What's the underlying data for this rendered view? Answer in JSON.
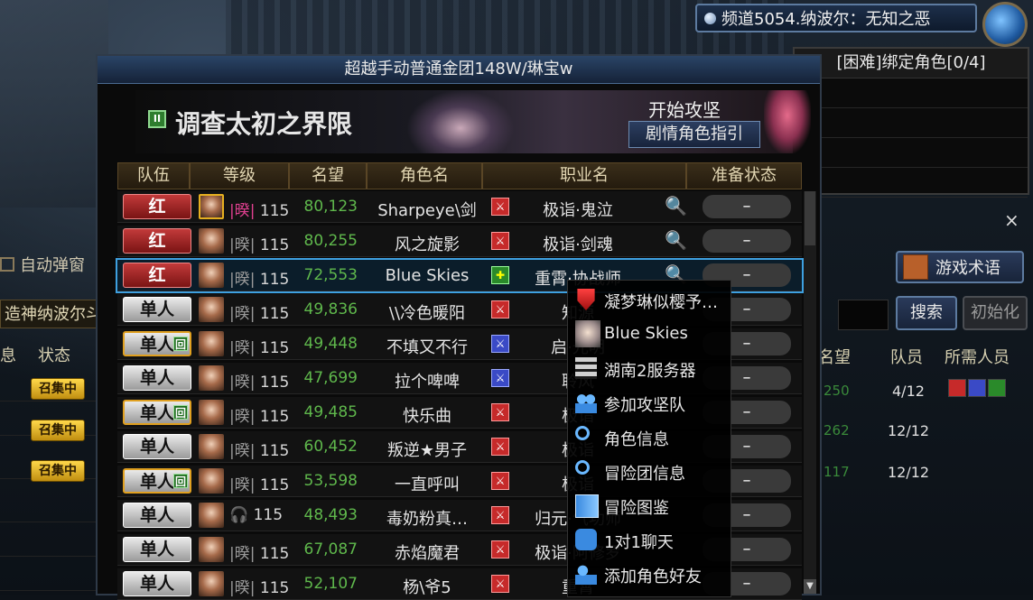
{
  "channel": {
    "text": "频道5054.纳波尔：无知之恶"
  },
  "right_panel": {
    "title": "[困难]绑定角色[0/4]"
  },
  "background_list": {
    "auto_popup_label": "自动弹窗",
    "name_field": "造神纳波尔斗",
    "headers": {
      "info": "息",
      "status": "状态",
      "fame": "名望",
      "members": "队员",
      "needed": "所需人员"
    },
    "badge_label": "召集中",
    "rows": [
      {
        "members": "4/12",
        "fame_fragment": "250"
      },
      {
        "members": "12/12",
        "fame_fragment": "262"
      },
      {
        "members": "12/12",
        "fame_fragment": "117"
      }
    ],
    "buttons": {
      "terms": "游戏术语",
      "search": "搜索",
      "reset": "初始化"
    },
    "close_label": "×"
  },
  "window": {
    "title": "超越手动普通金团148W/琳宝w",
    "dungeon_name": "调查太初之界限",
    "start_label": "开始攻坚",
    "guide_button": "剧情角色指引",
    "pause_glyph": "II"
  },
  "table": {
    "headers": [
      "队伍",
      "等级",
      "名望",
      "角色名",
      "职业名",
      "准备状态"
    ],
    "rows": [
      {
        "team": "红",
        "team_type": "red",
        "rank_glyph": "|暌|",
        "level": "115",
        "fame": "80,123",
        "name": "Sharpeye\\剑",
        "job_type": "atk",
        "job": "极诣·鬼泣",
        "magnify": true,
        "ready": "–",
        "selected": false
      },
      {
        "team": "红",
        "team_type": "red",
        "rank_glyph": "|暌|",
        "level": "115",
        "fame": "80,255",
        "name": "风之旋影",
        "job_type": "atk",
        "job": "极诣·剑魂",
        "magnify": true,
        "ready": "–",
        "selected": false
      },
      {
        "team": "红",
        "team_type": "red",
        "rank_glyph": "|暌|",
        "level": "115",
        "fame": "72,553",
        "name": "Blue Skies",
        "job_type": "sup",
        "job": "重霄·协战师",
        "magnify": true,
        "ready": "–",
        "selected": true
      },
      {
        "team": "单人",
        "team_type": "solo",
        "rank_glyph": "|暌|",
        "level": "115",
        "fame": "49,836",
        "name": "\\\\冷色暖阳",
        "job_type": "atk",
        "job": "知源",
        "magnify": false,
        "ready": "–",
        "selected": false
      },
      {
        "team": "单人",
        "team_type": "solo-back",
        "rank_glyph": "|暌|",
        "level": "115",
        "fame": "49,448",
        "name": "不填又不行",
        "job_type": "buf",
        "job": "启·光明",
        "magnify": false,
        "ready": "–",
        "selected": false
      },
      {
        "team": "单人",
        "team_type": "solo",
        "rank_glyph": "|暌|",
        "level": "115",
        "fame": "47,699",
        "name": "拉个啤啤",
        "job_type": "buf",
        "job": "聆风",
        "magnify": false,
        "ready": "–",
        "selected": false
      },
      {
        "team": "单人",
        "team_type": "solo-back",
        "rank_glyph": "|暌|",
        "level": "115",
        "fame": "49,485",
        "name": "快乐曲",
        "job_type": "atk",
        "job": "极诣",
        "magnify": false,
        "ready": "–",
        "selected": false
      },
      {
        "team": "单人",
        "team_type": "solo",
        "rank_glyph": "|暌|",
        "level": "115",
        "fame": "60,452",
        "name": "叛逆★男子",
        "job_type": "atk",
        "job": "极诣",
        "magnify": false,
        "ready": "–",
        "selected": false
      },
      {
        "team": "单人",
        "team_type": "solo-back",
        "rank_glyph": "|暌|",
        "level": "115",
        "fame": "53,598",
        "name": "一直呼叫",
        "job_type": "atk",
        "job": "极诣",
        "magnify": false,
        "ready": "–",
        "selected": false
      },
      {
        "team": "单人",
        "team_type": "solo",
        "rank_glyph": "🎧",
        "level": "115",
        "fame": "48,493",
        "name": "毒奶粉真…",
        "job_type": "atk",
        "job": "归元·气功师",
        "magnify": false,
        "ready": "–",
        "selected": false
      },
      {
        "team": "单人",
        "team_type": "solo",
        "rank_glyph": "|暌|",
        "level": "115",
        "fame": "67,087",
        "name": "赤焰魔君",
        "job_type": "atk",
        "job": "极诣·阿修罗",
        "magnify": false,
        "ready": "–",
        "selected": false
      },
      {
        "team": "单人",
        "team_type": "solo",
        "rank_glyph": "|暌|",
        "level": "115",
        "fame": "52,107",
        "name": "杨\\爷5",
        "job_type": "atk",
        "job": "重霄",
        "magnify": false,
        "ready": "–",
        "selected": false
      }
    ]
  },
  "context_menu": {
    "items": [
      {
        "icon": "shield-icon",
        "label": "凝梦琳似樱予…"
      },
      {
        "icon": "portrait-icon",
        "label": "Blue Skies"
      },
      {
        "icon": "server-icon",
        "label": "湖南2服务器"
      },
      {
        "icon": "team-icon",
        "label": "参加攻坚队"
      },
      {
        "icon": "magnifier-icon",
        "label": "角色信息"
      },
      {
        "icon": "magnifier-icon",
        "label": "冒险团信息"
      },
      {
        "icon": "book-icon",
        "label": "冒险图鉴"
      },
      {
        "icon": "chat-icon",
        "label": "1对1聊天"
      },
      {
        "icon": "add-friend-icon",
        "label": "添加角色好友"
      }
    ]
  }
}
